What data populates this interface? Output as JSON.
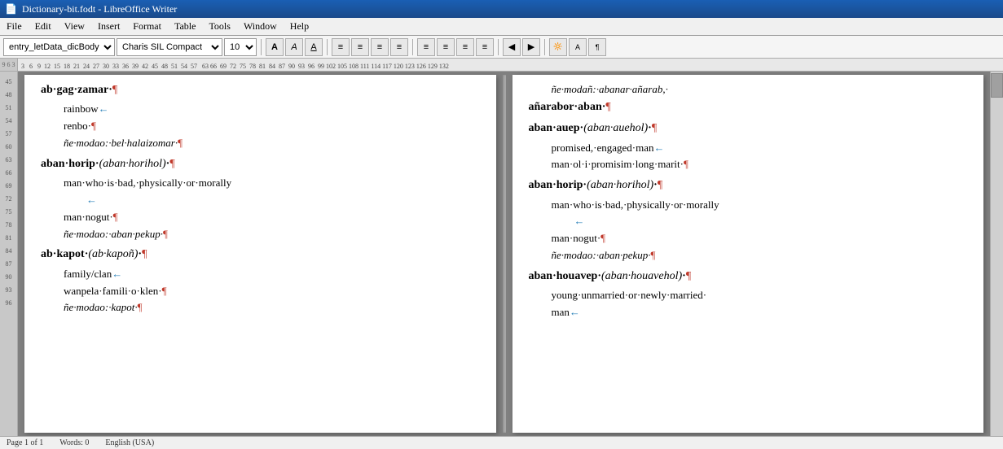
{
  "titleBar": {
    "title": "Dictionary-bit.fodt - LibreOffice Writer",
    "icon": "📄"
  },
  "menuBar": {
    "items": [
      "File",
      "Edit",
      "View",
      "Insert",
      "Format",
      "Table",
      "Tools",
      "Window",
      "Help"
    ]
  },
  "toolbar": {
    "styleSelect": "entry_letData_dicBody",
    "fontSelect": "Charis SIL Compact",
    "sizeSelect": "10",
    "buttons": [
      "A",
      "A",
      "A",
      "≡",
      "≡",
      "≡",
      "≡",
      "≡",
      "≡",
      "≡",
      "≡",
      "◀",
      "▶"
    ]
  },
  "ruler": {
    "ticks": [
      "9",
      "6",
      "3",
      "3",
      "6",
      "9",
      "12",
      "15",
      "18",
      "21",
      "24",
      "27",
      "30",
      "33",
      "36",
      "39",
      "42",
      "45",
      "48",
      "51",
      "54",
      "57"
    ]
  },
  "leftColumn": {
    "entries": [
      {
        "type": "main",
        "text": "ab·gag·zamar·¶"
      },
      {
        "type": "indent",
        "text": "rainbow←"
      },
      {
        "type": "indent",
        "text": "renbo·¶"
      },
      {
        "type": "indent",
        "text": "ñe·modao:·bel·halaizomar·¶"
      },
      {
        "type": "main",
        "text": "aban·horip·(aban·horihol)·¶"
      },
      {
        "type": "indent",
        "text": "man·who·is·bad,·physically·or·morally"
      },
      {
        "type": "indent2",
        "text": "←"
      },
      {
        "type": "indent",
        "text": "man·nogut·¶"
      },
      {
        "type": "indent",
        "text": "ñe·modao:·aban·pekup·¶"
      },
      {
        "type": "main",
        "text": "ab·kapot·(ab·kapoñ)·¶"
      },
      {
        "type": "indent",
        "text": "family/clan←"
      },
      {
        "type": "indent",
        "text": "wanpela·famili·o·klen·¶"
      },
      {
        "type": "indent",
        "text": "ñe·modao:·kapot·¶"
      }
    ]
  },
  "rightColumn": {
    "entries": [
      {
        "type": "indent",
        "text": "ñe·modañ:·abanar·añarab,·"
      },
      {
        "type": "indent",
        "text": "añarabor·aban·¶"
      },
      {
        "type": "main",
        "text": "aban·auep·(aban·auehol)·¶"
      },
      {
        "type": "indent",
        "text": "promised,·engaged·man←"
      },
      {
        "type": "indent",
        "text": "man·ol·i·promisim·long·marit·¶"
      },
      {
        "type": "main",
        "text": "aban·horip·(aban·horihol)·¶"
      },
      {
        "type": "indent",
        "text": "man·who·is·bad,·physically·or·morally"
      },
      {
        "type": "indent2",
        "text": "←"
      },
      {
        "type": "indent",
        "text": "man·nogut·¶"
      },
      {
        "type": "indent",
        "text": "ñe·modao:·aban·pekup·¶"
      },
      {
        "type": "main",
        "text": "aban·houavep·(aban·houavehol)·¶"
      },
      {
        "type": "indent",
        "text": "young·unmarried·or·newly·married·"
      },
      {
        "type": "indent",
        "text": "man←"
      }
    ]
  },
  "marginNumbers": [
    "45",
    "48",
    "51",
    "54",
    "57",
    "60",
    "63",
    "66",
    "69",
    "72",
    "75",
    "78",
    "81",
    "84",
    "87",
    "90",
    "93",
    "96"
  ]
}
